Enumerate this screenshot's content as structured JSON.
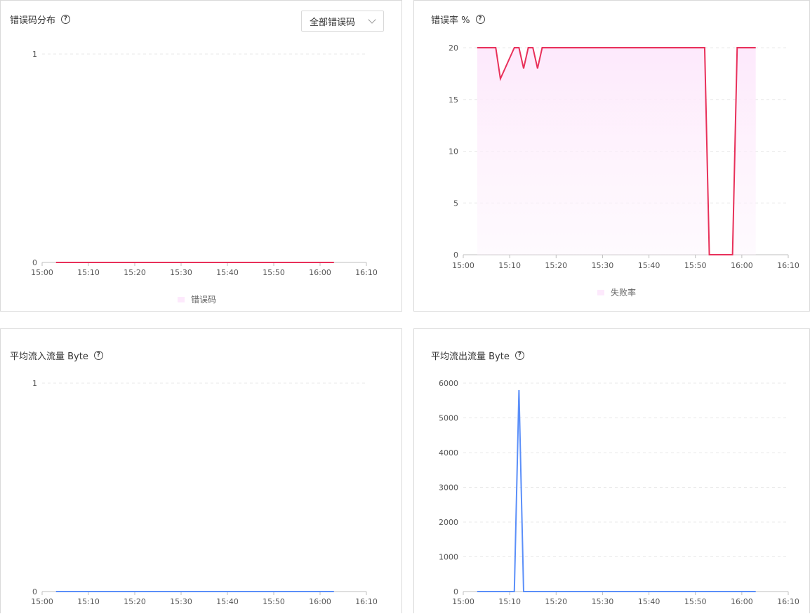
{
  "chart_data": [
    {
      "type": "line",
      "title": "错误码分布",
      "help_icon": "help-circle-icon",
      "filter_dropdown": {
        "selected": "全部错误码"
      },
      "x_ticks": [
        "15:00",
        "15:10",
        "15:20",
        "15:30",
        "15:40",
        "15:50",
        "16:00",
        "16:10"
      ],
      "x_range_min": [
        900,
        970
      ],
      "y_ticks": [
        "0",
        "1"
      ],
      "ylim": [
        0,
        1
      ],
      "series": [
        {
          "name": "错误码",
          "color": "#e8305a",
          "legend_swatch_color": "#fde9fc",
          "x_min": [
            903,
            963
          ],
          "values": [
            0,
            0
          ]
        }
      ],
      "legend": "bottom-center",
      "grid": "horizontal-dashed"
    },
    {
      "type": "area",
      "title": "错误率 %",
      "help_icon": "help-circle-icon",
      "x_ticks": [
        "15:00",
        "15:10",
        "15:20",
        "15:30",
        "15:40",
        "15:50",
        "16:00",
        "16:10"
      ],
      "x_range_min": [
        900,
        970
      ],
      "y_ticks": [
        "0",
        "5",
        "10",
        "15",
        "20"
      ],
      "ylim": [
        0,
        20
      ],
      "series": [
        {
          "name": "失败率",
          "color": "#e8305a",
          "fill_color": "#fde9fc",
          "legend_swatch_color": "#fde9fc",
          "x_min": [
            903,
            907,
            908,
            909,
            911,
            912,
            913,
            914,
            915,
            916,
            917,
            952,
            953,
            958,
            959,
            963
          ],
          "values": [
            20,
            20,
            17,
            18,
            20,
            20,
            18,
            20,
            20,
            18,
            20,
            20,
            0,
            0,
            20,
            20
          ]
        }
      ],
      "legend": "bottom-center",
      "grid": "horizontal-dashed"
    },
    {
      "type": "line",
      "title": "平均流入流量 Byte",
      "help_icon": "help-circle-icon",
      "x_ticks": [
        "15:00",
        "15:10",
        "15:20",
        "15:30",
        "15:40",
        "15:50",
        "16:00",
        "16:10"
      ],
      "x_range_min": [
        900,
        970
      ],
      "y_ticks": [
        "0",
        "1"
      ],
      "ylim": [
        0,
        1
      ],
      "series": [
        {
          "color": "#5b8ff9",
          "x_min": [
            903,
            963
          ],
          "values": [
            0,
            0
          ]
        }
      ],
      "grid": "horizontal-dashed"
    },
    {
      "type": "line",
      "title": "平均流出流量 Byte",
      "help_icon": "help-circle-icon",
      "x_ticks": [
        "15:00",
        "15:10",
        "15:20",
        "15:30",
        "15:40",
        "15:50",
        "16:00",
        "16:10"
      ],
      "x_range_min": [
        900,
        970
      ],
      "y_ticks": [
        "0",
        "1000",
        "2000",
        "3000",
        "4000",
        "5000",
        "6000"
      ],
      "ylim": [
        0,
        6000
      ],
      "series": [
        {
          "color": "#5b8ff9",
          "x_min": [
            903,
            911,
            912,
            913,
            963
          ],
          "values": [
            0,
            0,
            5800,
            0,
            0
          ]
        }
      ],
      "grid": "horizontal-dashed"
    }
  ]
}
